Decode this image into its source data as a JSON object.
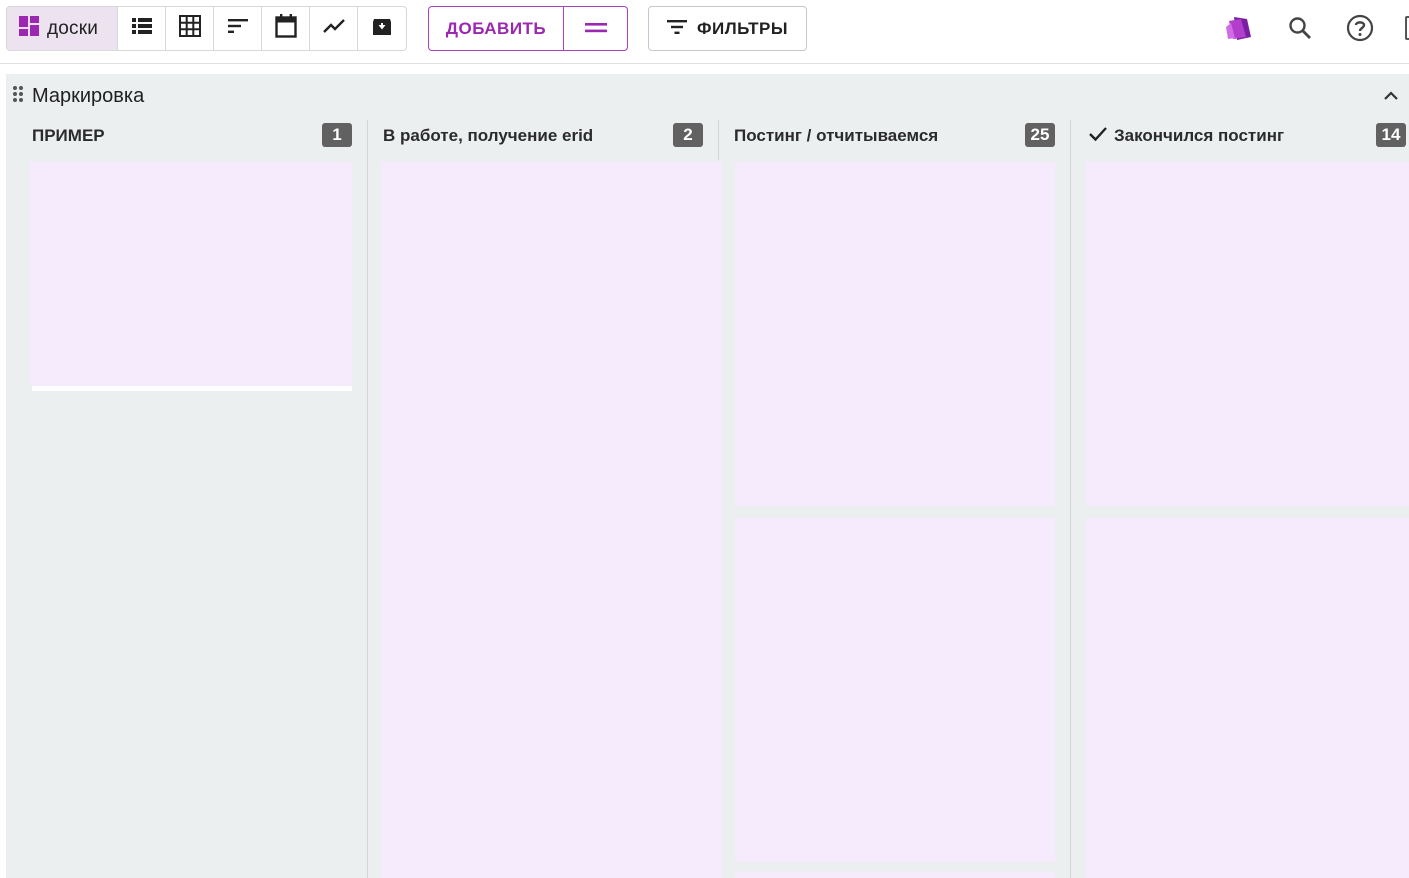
{
  "toolbar": {
    "views": [
      {
        "label": "доски",
        "icon": "boards-icon",
        "active": true
      },
      {
        "icon": "list-icon"
      },
      {
        "icon": "table-icon"
      },
      {
        "icon": "sort-icon"
      },
      {
        "icon": "calendar-icon"
      },
      {
        "icon": "chart-icon"
      },
      {
        "icon": "archive-icon"
      }
    ],
    "add_label": "ДОБАВИТЬ",
    "filters_label": "ФИЛЬТРЫ",
    "right_icons": [
      "tag-icon",
      "search-icon",
      "help-icon"
    ]
  },
  "board": {
    "title": "Маркировка",
    "columns": [
      {
        "title": "ПРИМЕР",
        "count": "1"
      },
      {
        "title": "В работе, получение erid",
        "count": "2"
      },
      {
        "title": "Постинг / отчитываемся",
        "count": "25"
      },
      {
        "title": "Закончился постинг",
        "count": "14",
        "icon": "check-icon"
      }
    ]
  },
  "colors": {
    "accent": "#9c27b0",
    "active_view_bg": "#ede2ef",
    "board_bg": "#eceff0",
    "card_bg": "#f5ebfc",
    "badge_bg": "#616161"
  }
}
